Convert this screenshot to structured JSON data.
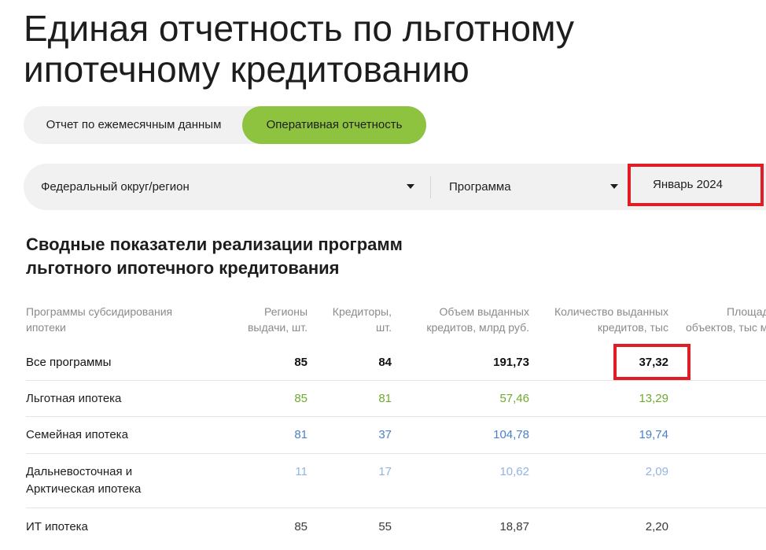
{
  "page": {
    "title_line1": "Единая отчетность по льготному",
    "title_line2": "ипотечному кредитованию"
  },
  "tabs": [
    {
      "label": "Отчет по ежемесячным данным",
      "active": false
    },
    {
      "label": "Оперативная отчетность",
      "active": true
    }
  ],
  "filters": {
    "region": "Федеральный округ/регион",
    "program": "Программа",
    "period": "Январь 2024"
  },
  "section": {
    "title_line1": "Сводные показатели реализации программ",
    "title_line2": "льготного ипотечного кредитования"
  },
  "table": {
    "headers": {
      "name": [
        "Программы субсидирования",
        "ипотеки"
      ],
      "regions": [
        "Регионы",
        "выдачи, шт."
      ],
      "creditors": [
        "Кредиторы,",
        "шт."
      ],
      "volume": [
        "Объем выданных",
        "кредитов, млрд руб."
      ],
      "count": [
        "Количество выданных",
        "кредитов, тыс"
      ],
      "area": [
        "Площад",
        "объектов, тыс м"
      ]
    },
    "rows": [
      {
        "name": "Все программы",
        "regions": "85",
        "creditors": "84",
        "volume": "191,73",
        "count": "37,32"
      },
      {
        "name": "Льготная ипотека",
        "regions": "85",
        "creditors": "81",
        "volume": "57,46",
        "count": "13,29"
      },
      {
        "name": "Семейная ипотека",
        "regions": "81",
        "creditors": "37",
        "volume": "104,78",
        "count": "19,74"
      },
      {
        "name_line1": "Дальневосточная и",
        "name_line2": "Арктическая ипотека",
        "regions": "11",
        "creditors": "17",
        "volume": "10,62",
        "count": "2,09"
      },
      {
        "name": "ИТ ипотека",
        "regions": "85",
        "creditors": "55",
        "volume": "18,87",
        "count": "2,20"
      }
    ]
  },
  "colors": {
    "accent_green": "#8ec33f",
    "highlight_red": "#e01d25",
    "value_green": "#6faa2d",
    "value_blue": "#4a80c8",
    "value_lightblue": "#93b4e3"
  }
}
